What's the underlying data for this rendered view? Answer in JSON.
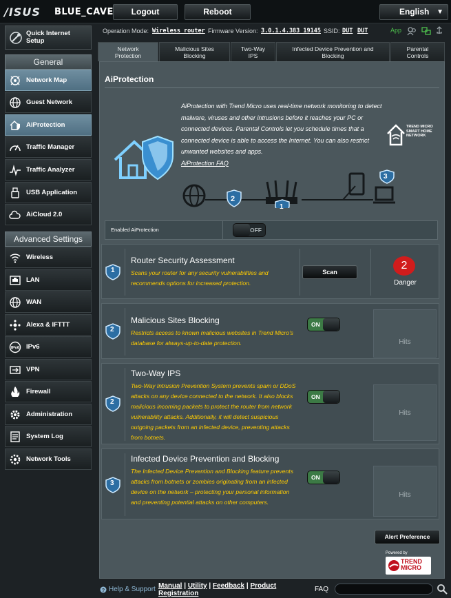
{
  "header": {
    "brand": "/ISUS",
    "model": "BLUE_CAVE",
    "logout_label": "Logout",
    "reboot_label": "Reboot",
    "language": "English"
  },
  "status_bar": {
    "op_mode_label": "Operation Mode:",
    "op_mode_value": "Wireless router",
    "firmware_label": "Firmware Version:",
    "firmware_value": "3.0.1.4.383_19145",
    "ssid_label": "SSID:",
    "ssid_value_1": "DUT",
    "ssid_value_2": "DUT",
    "app_label": "App"
  },
  "sidebar": {
    "quick_setup": "Quick Internet Setup",
    "general_header": "General",
    "general_items": [
      {
        "label": "Network Map",
        "active": true
      },
      {
        "label": "Guest Network",
        "active": false
      },
      {
        "label": "AiProtection",
        "active": true
      },
      {
        "label": "Traffic Manager",
        "active": false
      },
      {
        "label": "Traffic Analyzer",
        "active": false
      },
      {
        "label": "USB Application",
        "active": false
      },
      {
        "label": "AiCloud 2.0",
        "active": false
      }
    ],
    "advanced_header": "Advanced Settings",
    "advanced_items": [
      {
        "label": "Wireless"
      },
      {
        "label": "LAN"
      },
      {
        "label": "WAN"
      },
      {
        "label": "Alexa & IFTTT"
      },
      {
        "label": "IPv6"
      },
      {
        "label": "VPN"
      },
      {
        "label": "Firewall"
      },
      {
        "label": "Administration"
      },
      {
        "label": "System Log"
      },
      {
        "label": "Network Tools"
      }
    ]
  },
  "tabs": [
    {
      "label": "Network Protection",
      "active": true
    },
    {
      "label": "Malicious Sites Blocking",
      "active": false
    },
    {
      "label": "Two-Way IPS",
      "active": false
    },
    {
      "label": "Infected Device Prevention and Blocking",
      "active": false
    },
    {
      "label": "Parental Controls",
      "active": false
    }
  ],
  "main": {
    "title": "AiProtection",
    "intro": "AiProtection with Trend Micro uses real-time network monitoring to detect malware, viruses and other intrusions before it reaches your PC or connected devices. Parental Controls let you schedule times that a connected device is able to access the Internet. You can also restrict unwanted websites and apps.",
    "faq_link": "AiProtection FAQ",
    "smart_home_label": "TREND MICRO SMART HOME NETWORK",
    "enabled_label": "Enabled AiProtection",
    "enabled_state": "OFF",
    "diagram_numbers": [
      "2",
      "1",
      "3"
    ]
  },
  "blocks": {
    "rsa": {
      "number": "1",
      "title": "Router Security Assessment",
      "desc": "Scans your router for any security vulnerabilities and recommends options for increased protection.",
      "scan_label": "Scan",
      "badge_count": "2",
      "badge_label": "Danger"
    },
    "msb": {
      "number": "2",
      "title": "Malicious Sites Blocking",
      "desc": "Restricts access to known malicious websites in Trend Micro's database for always-up-to-date protection.",
      "toggle": "ON",
      "hits": "Hits"
    },
    "ips": {
      "number": "2",
      "title": "Two-Way IPS",
      "desc": "Two-Way Intrusion Prevention System prevents spam or DDoS attacks on any device connected to the network. It also blocks malicious incoming packets to protect the router from network vulnerability attacks. Additionally, it will detect suspicious outgoing packets from an infected device, preventing attacks from botnets.",
      "toggle": "ON",
      "hits": "Hits"
    },
    "idp": {
      "number": "3",
      "title": "Infected Device Prevention and Blocking",
      "desc": "The Infected Device Prevention and Blocking feature prevents attacks from botnets or zombies originating from an infected device on the network – protecting your personal information and preventing potential attacks on other computers.",
      "toggle": "ON",
      "hits": "Hits"
    }
  },
  "alert_label": "Alert Preference",
  "powered_by": "Powered by",
  "trend_logo": "TREND MICRO",
  "footer": {
    "help": "Help & Support",
    "manual": "Manual",
    "utility": "Utility",
    "feedback": "Feedback",
    "product_registration": "Product Registration",
    "faq": "FAQ",
    "faq_placeholder": ""
  },
  "colors": {
    "accent_blue": "#4f6f82",
    "danger_red": "#d11c1c",
    "desc_yellow": "#ffcc00",
    "toggle_green": "#3c7a45"
  }
}
